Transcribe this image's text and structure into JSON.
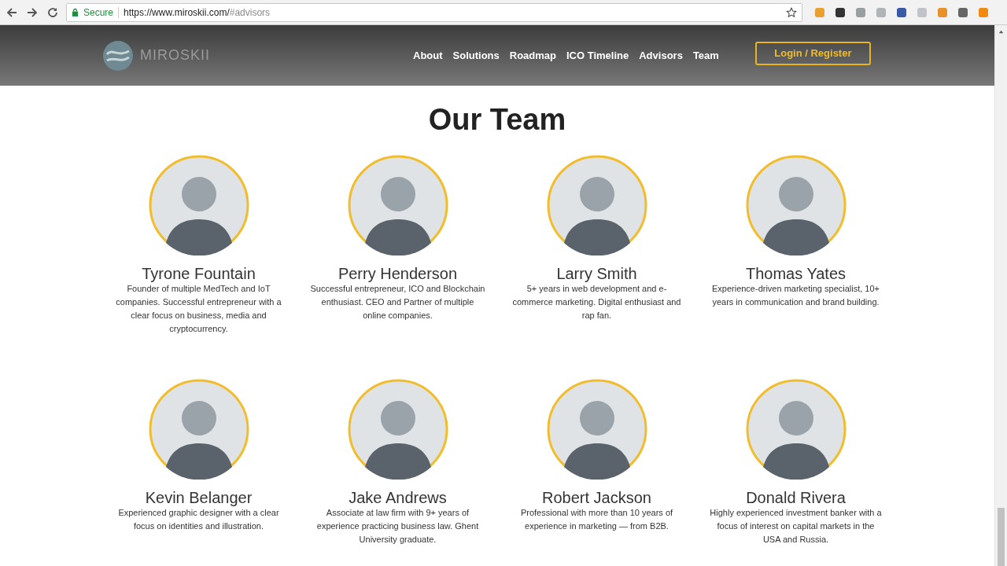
{
  "browser": {
    "secure_label": "Secure",
    "url_host": "https://www.miroskii.com/",
    "url_fragment": "#advisors"
  },
  "navbar": {
    "logo_text": "MIROSKII",
    "links": [
      {
        "label": "About"
      },
      {
        "label": "Solutions"
      },
      {
        "label": "Roadmap"
      },
      {
        "label": "ICO Timeline"
      },
      {
        "label": "Advisors"
      },
      {
        "label": "Team"
      }
    ],
    "login_button": "Login / Register"
  },
  "section": {
    "title": "Our Team"
  },
  "members": [
    {
      "name": "Tyrone Fountain",
      "bio": "Founder of multiple MedTech and IoT companies. Successful entrepreneur with a clear focus on business, media and cryptocurrency."
    },
    {
      "name": "Perry Henderson",
      "bio": "Successful entrepreneur, ICO and Blockchain enthusiast. CEO and Partner of multiple online companies."
    },
    {
      "name": "Larry Smith",
      "bio": "5+ years in web development and e-commerce marketing. Digital enthusiast and rap fan."
    },
    {
      "name": "Thomas Yates",
      "bio": "Experience-driven marketing specialist, 10+ years in communication and brand building."
    },
    {
      "name": "Kevin Belanger",
      "bio": "Experienced graphic designer with a clear focus on identities and illustration."
    },
    {
      "name": "Jake Andrews",
      "bio": "Associate at law firm with 9+ years of experience practicing business law. Ghent University graduate."
    },
    {
      "name": "Robert Jackson",
      "bio": "Professional with more than 10 years of experience in marketing — from B2B."
    },
    {
      "name": "Donald Rivera",
      "bio": "Highly experienced investment banker with a focus of interest on capital markets in the USA and Russia."
    }
  ]
}
